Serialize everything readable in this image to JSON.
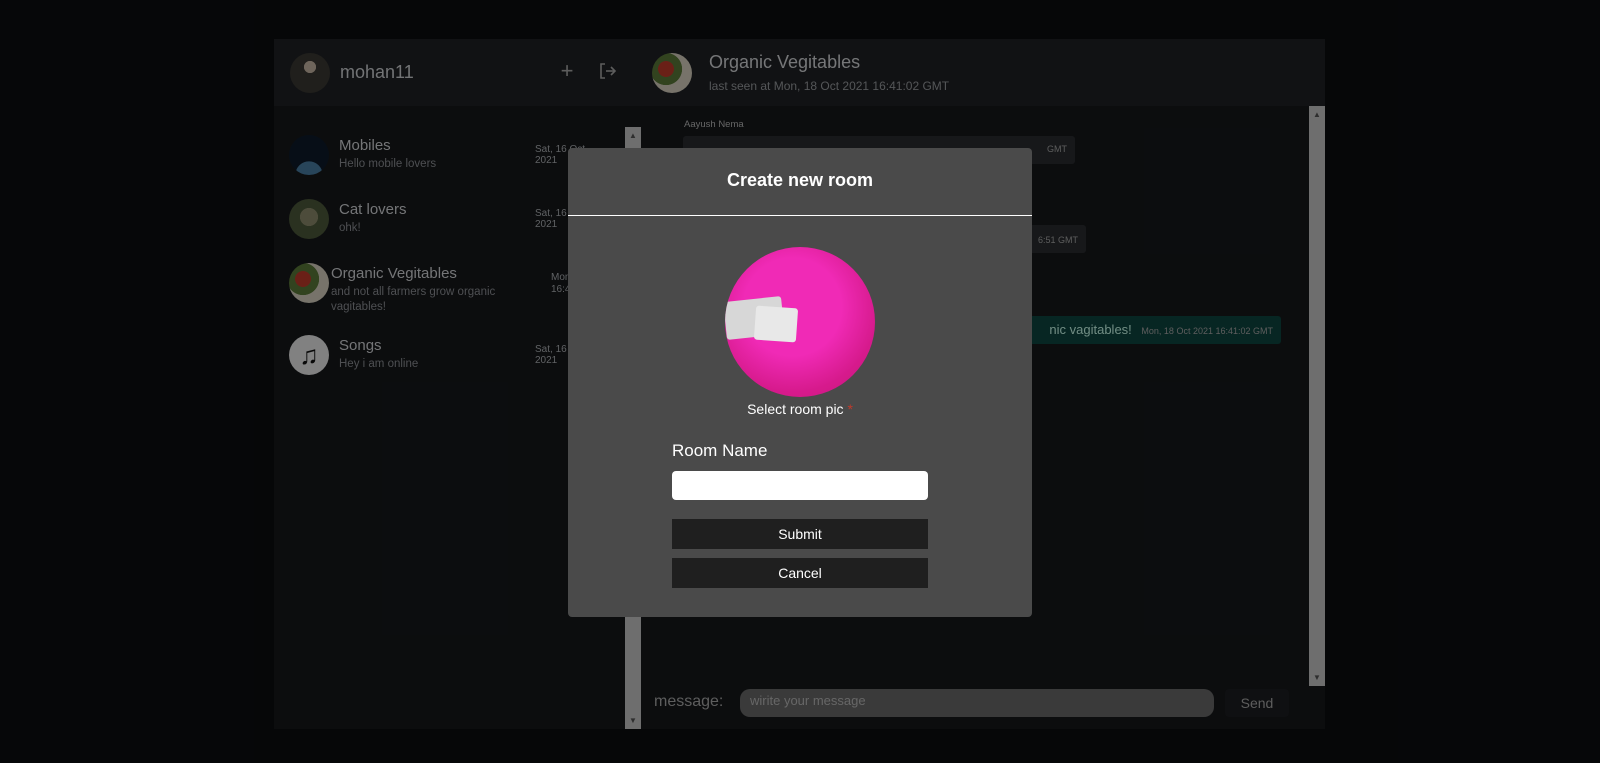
{
  "sidebar": {
    "username": "mohan11",
    "rooms": [
      {
        "name": "Mobiles",
        "last_message": "Hello mobile lovers",
        "time": "Sat, 16 Oct 2021"
      },
      {
        "name": "Cat lovers",
        "last_message": "ohk!",
        "time": "Sat, 16 Oct 2021"
      },
      {
        "name": "Organic Vegitables",
        "last_message": "and not all farmers grow organic vagitables!",
        "time": "Mon, 18 Oct 2021 16:41:02"
      },
      {
        "name": "Songs",
        "last_message": "Hey i am online",
        "time": "Sat, 16 Oct 2021"
      }
    ]
  },
  "chat": {
    "title": "Organic Vegitables",
    "subtitle": "last seen at Mon, 18 Oct 2021 16:41:02 GMT",
    "sender": "Aayush Nema",
    "messages": [
      {
        "text": "",
        "time": "GMT"
      },
      {
        "text": "",
        "time": "6:51 GMT"
      },
      {
        "text": "nic vagitables!",
        "time": "Mon, 18 Oct 2021 16:41:02 GMT"
      }
    ],
    "message_label": "message:",
    "message_placeholder": "wirite your message",
    "send_label": "Send"
  },
  "modal": {
    "title": "Create new room",
    "pic_label": "Select room pic",
    "required_mark": "*",
    "name_label": "Room Name",
    "submit_label": "Submit",
    "cancel_label": "Cancel"
  }
}
